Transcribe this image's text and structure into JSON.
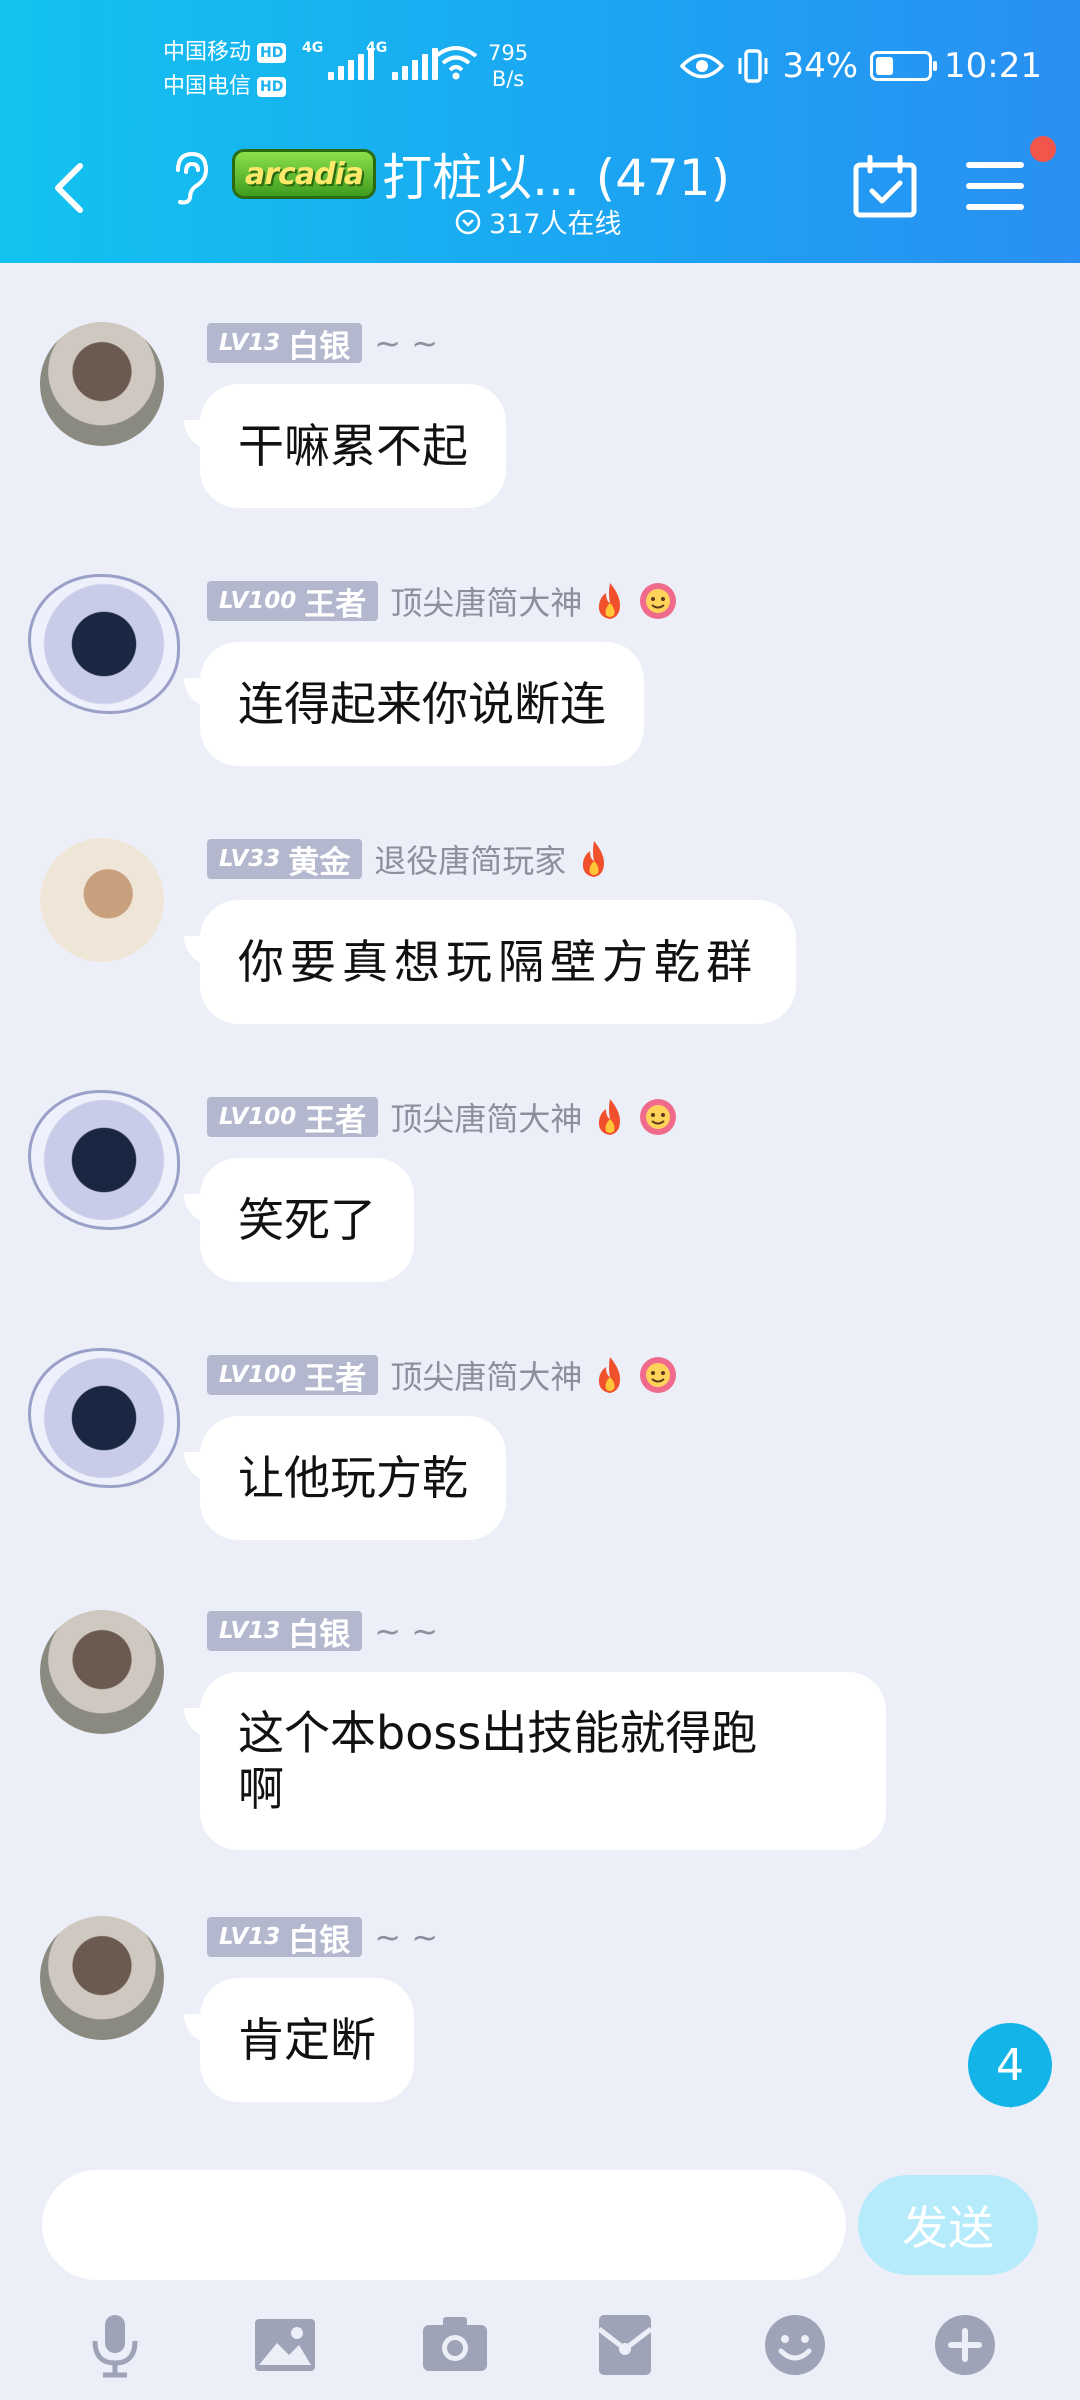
{
  "status_bar": {
    "carrier_1": "中国移动",
    "carrier_2": "中国电信",
    "hd": "HD",
    "net_1": "4G",
    "net_2": "4G",
    "speed_value": "795",
    "speed_unit": "B/s",
    "battery_percent": "34%",
    "battery_level": 0.34,
    "time": "10:21"
  },
  "header": {
    "logo_text": "arcadia",
    "title": "打桩以... (471)",
    "online_text": "317人在线"
  },
  "messages": [
    {
      "level": "LV13",
      "rank": "白银",
      "nickname": "~ ~",
      "text": "干嘛累不起",
      "avatar": "girl-avatar"
    },
    {
      "level": "LV100",
      "rank": "王者",
      "nickname": "顶尖唐简大神",
      "text": "连得起来你说断连",
      "avatar": "shark-avatar",
      "emojis": [
        "fire-icon",
        "flower-icon"
      ]
    },
    {
      "level": "LV33",
      "rank": "黄金",
      "nickname": "退役唐简玩家",
      "text": "你要真想玩隔壁方乾群",
      "avatar": "lady-avatar",
      "emojis": [
        "fire-icon"
      ]
    },
    {
      "level": "LV100",
      "rank": "王者",
      "nickname": "顶尖唐简大神",
      "text": "笑死了",
      "avatar": "shark-avatar",
      "emojis": [
        "fire-icon",
        "flower-icon"
      ]
    },
    {
      "level": "LV100",
      "rank": "王者",
      "nickname": "顶尖唐简大神",
      "text": "让他玩方乾",
      "avatar": "shark-avatar",
      "emojis": [
        "fire-icon",
        "flower-icon"
      ]
    },
    {
      "level": "LV13",
      "rank": "白银",
      "nickname": "~ ~",
      "text_line1": "这个本boss出技能就得跑",
      "text_line2": "啊",
      "avatar": "girl-avatar"
    },
    {
      "level": "LV13",
      "rank": "白银",
      "nickname": "~ ~",
      "text": "肯定断",
      "avatar": "girl-avatar"
    }
  ],
  "unread_count": "4",
  "input": {
    "placeholder": "",
    "send_label": "发送"
  },
  "toolbar": [
    "microphone-icon",
    "image-icon",
    "camera-icon",
    "red-packet-icon",
    "emoji-icon",
    "plus-icon"
  ],
  "colors": {
    "header_start": "#12c3ef",
    "header_end": "#2a8ff2",
    "chat_background": "#eceef8",
    "badge": "#b4b8cf",
    "send_button": "#b6ebfb",
    "unread_badge": "#13b4e8"
  }
}
